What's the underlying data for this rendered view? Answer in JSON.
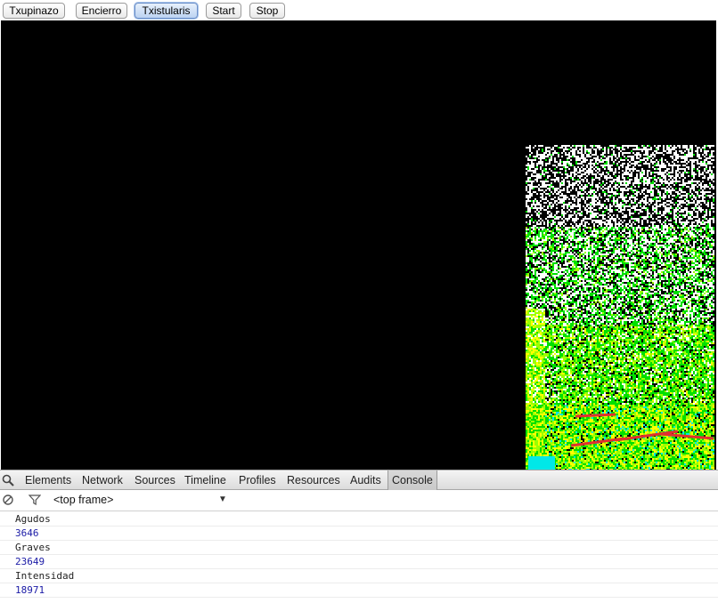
{
  "toolbar": {
    "buttons": [
      {
        "label": "Txupinazo",
        "active": false
      },
      {
        "label": "Encierro",
        "active": false
      },
      {
        "label": "Txistularis",
        "active": true
      },
      {
        "label": "Start",
        "active": false
      },
      {
        "label": "Stop",
        "active": false
      }
    ]
  },
  "spectrogram": {
    "background": "#000000",
    "palette": [
      "#ffffff",
      "#00e000",
      "#9cff00",
      "#ffff00",
      "#00e8e8",
      "#e03030"
    ]
  },
  "devtools": {
    "tabs": [
      "Elements",
      "Network",
      "Sources",
      "Timeline",
      "Profiles",
      "Resources",
      "Audits",
      "Console"
    ],
    "active_tab": "Console",
    "frame_selector": "<top frame>",
    "console": [
      {
        "text": "Agudos",
        "type": "label"
      },
      {
        "text": "3646",
        "type": "number"
      },
      {
        "text": "Graves",
        "type": "label"
      },
      {
        "text": "23649",
        "type": "number"
      },
      {
        "text": "Intensidad",
        "type": "label"
      },
      {
        "text": "18971",
        "type": "number"
      }
    ]
  }
}
